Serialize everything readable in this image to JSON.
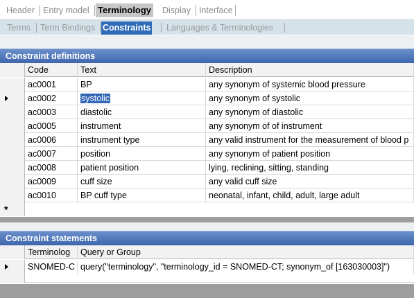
{
  "tabs_main": [
    {
      "label": "Header",
      "active": false
    },
    {
      "label": "Entry model",
      "active": false
    },
    {
      "label": "Terminology",
      "active": true
    },
    {
      "label": "Display",
      "active": false
    },
    {
      "label": "Interface",
      "active": false
    }
  ],
  "tabs_sub": [
    {
      "label": "Terms",
      "active": false
    },
    {
      "label": "Term Bindings",
      "active": false
    },
    {
      "label": "Constraints",
      "active": true
    },
    {
      "label": "Languages & Terminologies",
      "active": false
    }
  ],
  "definitions": {
    "title": "Constraint definitions",
    "columns": [
      "Code",
      "Text",
      "Description"
    ],
    "rows": [
      {
        "code": "ac0001",
        "text": "BP",
        "description": "any synonym of systemic blood pressure"
      },
      {
        "code": "ac0002",
        "text": "systolic",
        "description": "any synonym of systolic"
      },
      {
        "code": "ac0003",
        "text": "diastolic",
        "description": "any synonym of diastolic"
      },
      {
        "code": "ac0005",
        "text": "instrument",
        "description": "any synonym of of instrument"
      },
      {
        "code": "ac0006",
        "text": "instrument type",
        "description": "any valid instrument for the measurement of blood p"
      },
      {
        "code": "ac0007",
        "text": "position",
        "description": "any synonym of patient position"
      },
      {
        "code": "ac0008",
        "text": "patient position",
        "description": "lying, reclining, sitting, standing"
      },
      {
        "code": "ac0009",
        "text": "cuff size",
        "description": "any valid cuff size"
      },
      {
        "code": "ac0010",
        "text": "BP cuff type",
        "description": "neonatal, infant, child, adult, large adult"
      }
    ],
    "new_row_marker": "*"
  },
  "statements": {
    "title": "Constraint statements",
    "columns": [
      "Terminolog",
      "Query or Group"
    ],
    "rows": [
      {
        "terminology": "SNOMED-C",
        "query": "query(\"terminology\", \"terminology_id = SNOMED-CT; synonym_of [163030003]\")"
      }
    ]
  },
  "colors": {
    "section_header": "#4a70b4",
    "active_sub_tab": "#2f6bb6",
    "selection": "#3165b5"
  }
}
